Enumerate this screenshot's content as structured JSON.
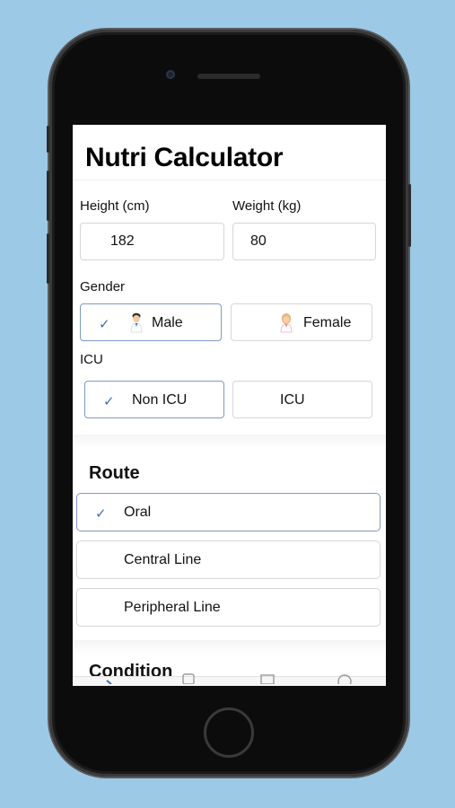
{
  "app": {
    "title": "Nutri Calculator"
  },
  "measurements": {
    "height": {
      "label": "Height (cm)",
      "value": "182"
    },
    "weight": {
      "label": "Weight (kg)",
      "value": "80"
    }
  },
  "gender": {
    "label": "Gender",
    "options": [
      {
        "label": "Male",
        "selected": true,
        "icon": "male-doctor-icon"
      },
      {
        "label": "Female",
        "selected": false,
        "icon": "female-doctor-icon"
      }
    ]
  },
  "icu": {
    "label": "ICU",
    "options": [
      {
        "label": "Non ICU",
        "selected": true
      },
      {
        "label": "ICU",
        "selected": false
      }
    ]
  },
  "route": {
    "title": "Route",
    "options": [
      {
        "label": "Oral",
        "selected": true
      },
      {
        "label": "Central Line",
        "selected": false
      },
      {
        "label": "Peripheral Line",
        "selected": false
      }
    ]
  },
  "condition": {
    "title": "Condition"
  },
  "check_glyph": "✓",
  "colors": {
    "accent": "#3f6fb6",
    "selected_border": "#7e99c8",
    "background": "#9cc9e6"
  },
  "tabbar": {
    "icons": [
      "calculator-icon",
      "clipboard-icon",
      "book-icon",
      "info-icon"
    ]
  }
}
